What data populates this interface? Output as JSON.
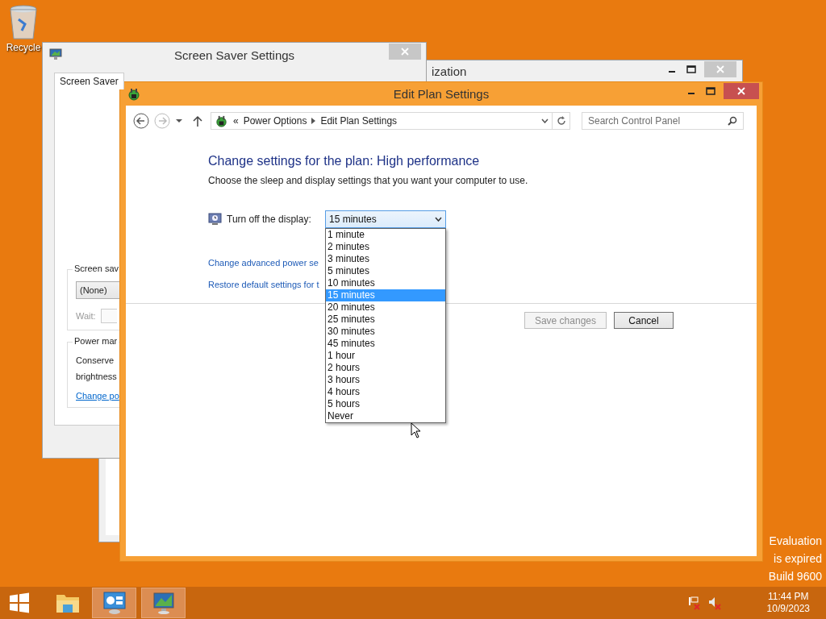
{
  "desktop_icons": [
    {
      "label": "Recycle"
    }
  ],
  "screen_saver_window": {
    "title": "Screen Saver Settings",
    "tabs": [
      {
        "label": "Screen Saver",
        "selected": true
      }
    ],
    "screen_saver_group": {
      "label": "Screen sav",
      "value": "(None)",
      "wait_label": "Wait:"
    },
    "power_group": {
      "label": "Power mar",
      "text_lines": [
        "Conserve",
        "brightness"
      ],
      "link": "Change po"
    }
  },
  "background_window": {
    "title": "ization"
  },
  "edit_plan_window": {
    "title": "Edit Plan Settings",
    "breadcrumb_prefix": "«",
    "breadcrumb": [
      "Power Options",
      "Edit Plan Settings"
    ],
    "search": {
      "placeholder": "Search Control Panel"
    },
    "heading": "Change settings for the plan: High performance",
    "description": "Choose the sleep and display settings that you want your computer to use.",
    "display_setting": {
      "label": "Turn off the display:",
      "value": "15 minutes",
      "expanded": true,
      "options": [
        {
          "label": "1 minute",
          "selected": false
        },
        {
          "label": "2 minutes",
          "selected": false
        },
        {
          "label": "3 minutes",
          "selected": false
        },
        {
          "label": "5 minutes",
          "selected": false
        },
        {
          "label": "10 minutes",
          "selected": false
        },
        {
          "label": "15 minutes",
          "selected": true
        },
        {
          "label": "20 minutes",
          "selected": false
        },
        {
          "label": "25 minutes",
          "selected": false
        },
        {
          "label": "30 minutes",
          "selected": false
        },
        {
          "label": "45 minutes",
          "selected": false
        },
        {
          "label": "1 hour",
          "selected": false
        },
        {
          "label": "2 hours",
          "selected": false
        },
        {
          "label": "3 hours",
          "selected": false
        },
        {
          "label": "4 hours",
          "selected": false
        },
        {
          "label": "5 hours",
          "selected": false
        },
        {
          "label": "Never",
          "selected": false
        }
      ]
    },
    "links": [
      "Change advanced power se",
      "Restore default settings for t"
    ],
    "buttons": [
      {
        "label": "Save changes",
        "disabled": true
      },
      {
        "label": "Cancel",
        "disabled": false
      }
    ]
  },
  "activation_notice": [
    "Evaluation",
    "is expired",
    "Build 9600"
  ],
  "taskbar": {
    "apps": [
      {
        "kind": "folder",
        "active": false
      },
      {
        "kind": "control-panel",
        "active": true
      },
      {
        "kind": "display",
        "active": true
      }
    ],
    "clock": {
      "time": "11:44 PM",
      "date": "10/9/2023"
    }
  }
}
